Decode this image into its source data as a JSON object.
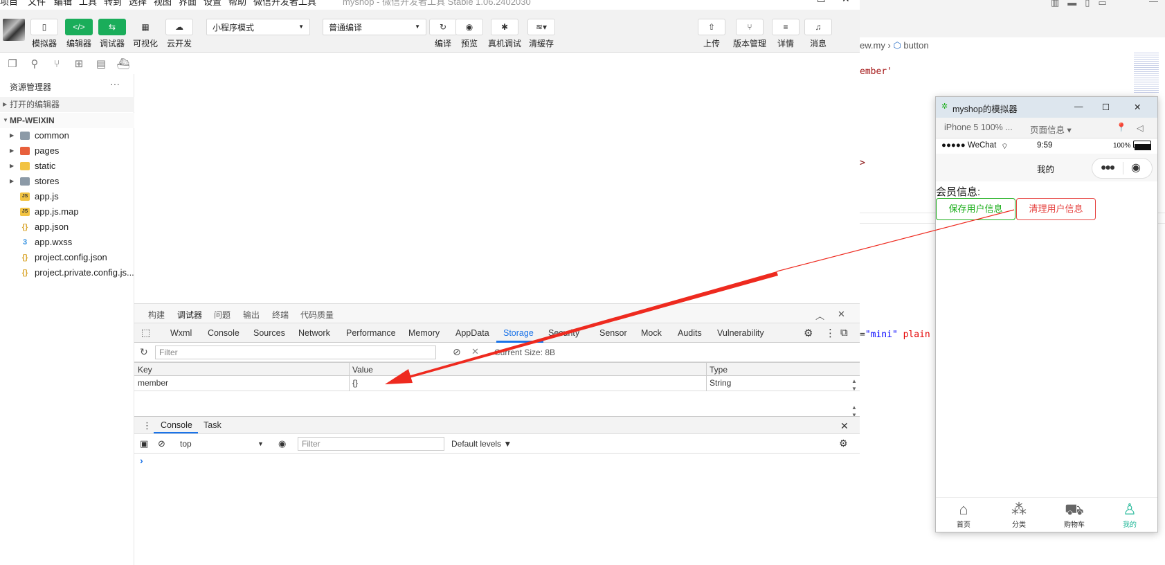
{
  "menubar": {
    "items": [
      "项目",
      "文件",
      "编辑",
      "工具",
      "转到",
      "选择",
      "视图",
      "界面",
      "设置",
      "帮助",
      "微信开发者工具"
    ],
    "window_title": "myshop - 微信开发者工具 Stable 1.06.2402030"
  },
  "toolbar": {
    "left_buttons": [
      {
        "label": "模拟器",
        "icon": "phone-icon"
      },
      {
        "label": "编辑器",
        "icon": "code-icon"
      },
      {
        "label": "调试器",
        "icon": "debug-icon"
      },
      {
        "label": "可视化",
        "icon": "layout-icon"
      },
      {
        "label": "云开发",
        "icon": "cloud-icon"
      }
    ],
    "mode_select": "小程序模式",
    "compile_select": "普通编译",
    "mid_buttons": [
      {
        "label": "编译",
        "icon": "refresh-icon"
      },
      {
        "label": "预览",
        "icon": "eye-icon"
      },
      {
        "label": "真机调试",
        "icon": "bug-icon"
      },
      {
        "label": "清缓存",
        "icon": "layers-icon"
      }
    ],
    "right_buttons": [
      {
        "label": "上传",
        "icon": "upload-icon"
      },
      {
        "label": "版本管理",
        "icon": "branch-icon"
      },
      {
        "label": "详情",
        "icon": "menu-icon"
      },
      {
        "label": "消息",
        "icon": "bell-icon"
      }
    ]
  },
  "sidebar": {
    "header": "资源管理器",
    "more": "···",
    "open_editors": "打开的编辑器",
    "project": "MP-WEIXIN",
    "tree": [
      {
        "label": "common",
        "type": "folder"
      },
      {
        "label": "pages",
        "type": "folder-pages"
      },
      {
        "label": "static",
        "type": "folder-static"
      },
      {
        "label": "stores",
        "type": "folder"
      },
      {
        "label": "app.js",
        "type": "js"
      },
      {
        "label": "app.js.map",
        "type": "js"
      },
      {
        "label": "app.json",
        "type": "json"
      },
      {
        "label": "app.wxss",
        "type": "wxss"
      },
      {
        "label": "project.config.json",
        "type": "json"
      },
      {
        "label": "project.private.config.js...",
        "type": "json"
      }
    ]
  },
  "devtools": {
    "top_tabs": [
      "构建",
      "调试器",
      "问题",
      "输出",
      "终端",
      "代码质量"
    ],
    "active_top_tab": "调试器",
    "panel_tabs": [
      "Wxml",
      "Console",
      "Sources",
      "Network",
      "Performance",
      "Memory",
      "AppData",
      "Storage",
      "Security",
      "Sensor",
      "Mock",
      "Audits",
      "Vulnerability"
    ],
    "active_panel_tab": "Storage",
    "filter_placeholder": "Filter",
    "current_size": "Current Size: 8B",
    "columns": [
      "Key",
      "Value",
      "Type"
    ],
    "rows": [
      {
        "key": "member",
        "value": "{}",
        "type": "String"
      }
    ],
    "drawer_tabs": [
      "Console",
      "Task"
    ],
    "context": "top",
    "console_filter": "Filter",
    "levels": "Default levels ▼",
    "prompt": "›"
  },
  "editor": {
    "breadcrumb_file": "ew.my",
    "breadcrumb_sep": "›",
    "breadcrumb_node": "button",
    "code_line1": "ember'",
    "code_line2": ">",
    "code_line3_a": "=",
    "code_line3_b": "\"mini\"",
    "code_line3_c": " plain t"
  },
  "simulator": {
    "title": "myshop的模拟器",
    "device": "iPhone 5 100% ...",
    "page_info": "页面信息 ▾",
    "carrier": "●●●●● WeChat",
    "time": "9:59",
    "battery": "100%",
    "nav_title": "我的",
    "member_label": "会员信息:",
    "save_button": "保存用户信息",
    "clear_button": "清理用户信息",
    "tabs": [
      {
        "label": "首页",
        "icon": "home-icon"
      },
      {
        "label": "分类",
        "icon": "category-icon"
      },
      {
        "label": "购物车",
        "icon": "cart-icon"
      },
      {
        "label": "我的",
        "icon": "user-icon"
      }
    ],
    "active_tab": "我的",
    "colors": {
      "green": "#1aad19",
      "red": "#e64340",
      "tab_active": "#27ba9b"
    }
  },
  "annotation": {
    "arrow_color": "#ee2a1f"
  }
}
